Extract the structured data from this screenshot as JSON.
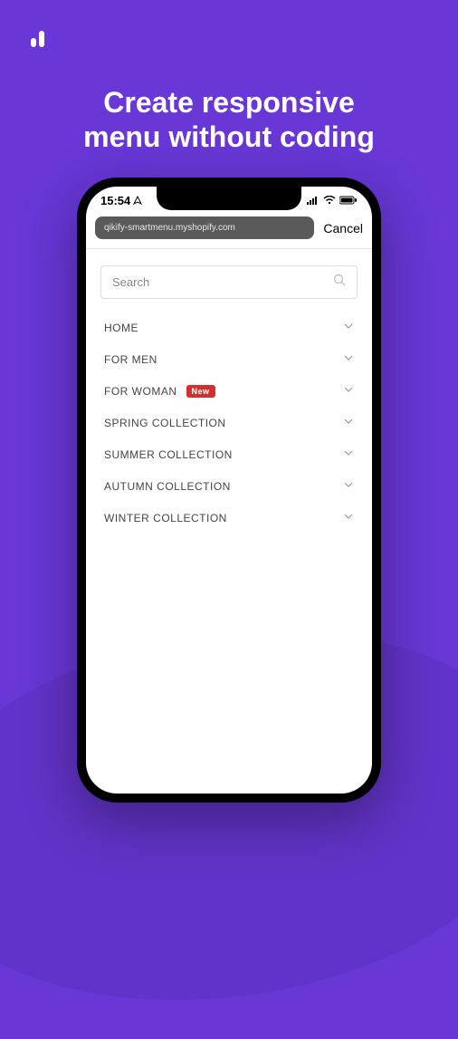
{
  "headline": {
    "line1": "Create responsive",
    "line2": "menu without coding"
  },
  "status": {
    "time": "15:54"
  },
  "addressbar": {
    "url": "qikify-smartmenu.myshopify.com",
    "cancel": "Cancel"
  },
  "search": {
    "placeholder": "Search"
  },
  "menu": [
    {
      "label": "HOME",
      "badge": null
    },
    {
      "label": "FOR MEN",
      "badge": null
    },
    {
      "label": "FOR WOMAN",
      "badge": "New"
    },
    {
      "label": "SPRING COLLECTION",
      "badge": null
    },
    {
      "label": "SUMMER COLLECTION",
      "badge": null
    },
    {
      "label": "AUTUMN COLLECTION",
      "badge": null
    },
    {
      "label": "WINTER COLLECTION",
      "badge": null
    }
  ]
}
